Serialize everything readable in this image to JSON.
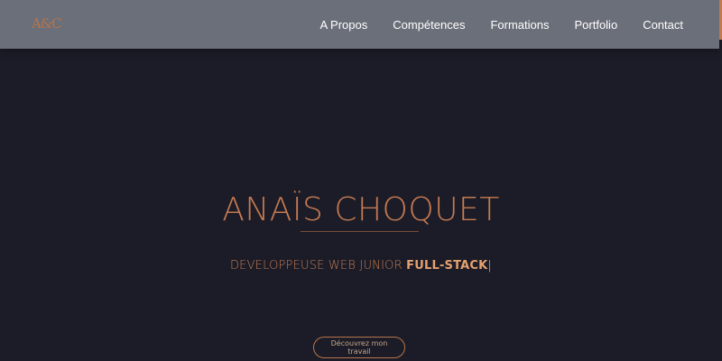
{
  "header": {
    "logo": "A&C",
    "nav": [
      {
        "label": "A Propos"
      },
      {
        "label": "Compétences"
      },
      {
        "label": "Formations"
      },
      {
        "label": "Portfolio"
      },
      {
        "label": "Contact"
      }
    ]
  },
  "hero": {
    "name": "ANAÏS CHOQUET",
    "subtitle_prefix": "DEVELOPPEUSE WEB JUNIOR ",
    "subtitle_highlight": "FULL-STACK",
    "cursor": "|",
    "cta_label": "Découvrez mon travail"
  },
  "colors": {
    "background": "#1b1c27",
    "navbar": "#6b6f79",
    "accent": "#c57a52",
    "highlight": "#e6a06e"
  }
}
